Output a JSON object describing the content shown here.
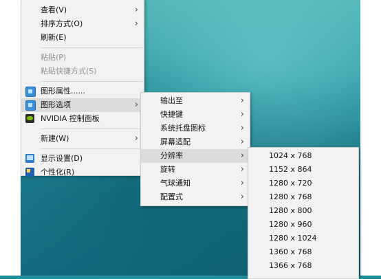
{
  "context_menu": {
    "items": [
      {
        "label": "查看(V)",
        "arrow": "›"
      },
      {
        "label": "排序方式(O)",
        "arrow": "›"
      },
      {
        "label": "刷新(E)"
      },
      {
        "label": "粘贴(P)"
      },
      {
        "label": "粘贴快捷方式(S)"
      },
      {
        "label": "图形属性......",
        "icon": "graphics-icon"
      },
      {
        "label": "图形选项",
        "icon": "graphics-icon",
        "arrow": "›"
      },
      {
        "label": "NVIDIA 控制面板",
        "icon": "nvidia-icon"
      },
      {
        "label": "新建(W)",
        "arrow": "›"
      },
      {
        "label": "显示设置(D)",
        "icon": "display-settings-icon"
      },
      {
        "label": "个性化(R)",
        "icon": "personalize-icon"
      }
    ]
  },
  "graphics_submenu": {
    "items": [
      {
        "label": "输出至",
        "arrow": "›"
      },
      {
        "label": "快捷键",
        "arrow": "›"
      },
      {
        "label": "系统托盘图标",
        "arrow": "›"
      },
      {
        "label": "屏幕适配",
        "arrow": "›"
      },
      {
        "label": "分辨率",
        "arrow": "›"
      },
      {
        "label": "旋转",
        "arrow": "›"
      },
      {
        "label": "气球通知",
        "arrow": "›"
      },
      {
        "label": "配置式",
        "arrow": "›"
      }
    ]
  },
  "resolution_submenu": {
    "items": [
      {
        "label": "1024 x 768"
      },
      {
        "label": "1152 x 864"
      },
      {
        "label": "1280 x 720"
      },
      {
        "label": "1280 x 768"
      },
      {
        "label": "1280 x 800"
      },
      {
        "label": "1280 x 960"
      },
      {
        "label": "1280 x 1024"
      },
      {
        "label": "1360 x 768"
      },
      {
        "label": "1366 x 768"
      }
    ]
  }
}
